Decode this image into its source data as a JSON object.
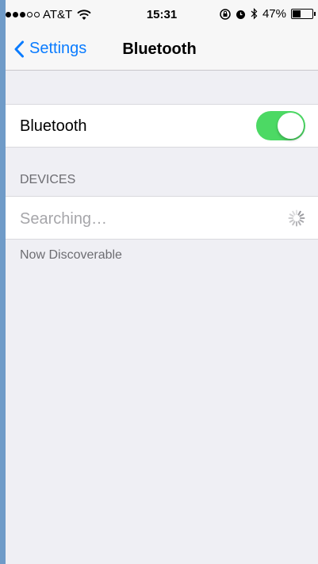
{
  "status_bar": {
    "carrier": "AT&T",
    "time": "15:31",
    "battery_percent_text": "47%",
    "battery_level": 0.47,
    "signal_bars_filled": 3,
    "signal_bars_total": 5,
    "icons": [
      "signal-dots-icon",
      "wifi-icon",
      "orientation-lock-icon",
      "alarm-icon",
      "bluetooth-icon",
      "battery-icon"
    ]
  },
  "nav": {
    "back_label": "Settings",
    "title": "Bluetooth"
  },
  "bluetooth_row": {
    "label": "Bluetooth",
    "enabled": true,
    "toggle_color": "#4cd964"
  },
  "devices": {
    "header": "DEVICES",
    "searching_label": "Searching…",
    "footer": "Now Discoverable"
  },
  "colors": {
    "accent": "#0a7cff",
    "background": "#efeff4"
  }
}
